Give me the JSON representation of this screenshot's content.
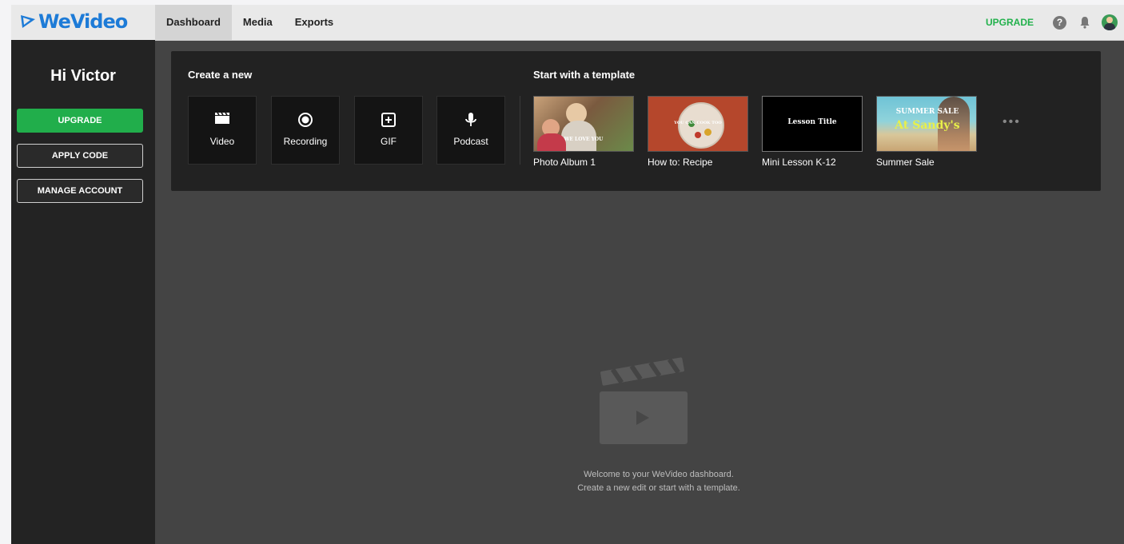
{
  "app": {
    "logo_text": "WeVideo"
  },
  "nav": {
    "tabs": [
      {
        "label": "Dashboard"
      },
      {
        "label": "Media"
      },
      {
        "label": "Exports"
      }
    ]
  },
  "topbar": {
    "upgrade_label": "UPGRADE",
    "help_glyph": "?"
  },
  "sidebar": {
    "greeting": "Hi Victor",
    "buttons": [
      {
        "label": "UPGRADE"
      },
      {
        "label": "APPLY CODE"
      },
      {
        "label": "MANAGE ACCOUNT"
      }
    ]
  },
  "create": {
    "heading": "Create a new",
    "items": [
      {
        "label": "Video",
        "icon": "clapperboard-icon"
      },
      {
        "label": "Recording",
        "icon": "record-icon"
      },
      {
        "label": "GIF",
        "icon": "gif-icon"
      },
      {
        "label": "Podcast",
        "icon": "microphone-icon"
      }
    ]
  },
  "templates": {
    "heading": "Start with a template",
    "items": [
      {
        "label": "Photo Album 1",
        "thumb_text": "WE LOVE YOU"
      },
      {
        "label": "How to: Recipe",
        "thumb_text": "YOU CAN COOK TOO"
      },
      {
        "label": "Mini Lesson K-12",
        "thumb_text": "Lesson Title"
      },
      {
        "label": "Summer Sale",
        "thumb_text": "SUMMER SALE",
        "thumb_text2": "At Sandy's"
      }
    ],
    "more_label": "•••"
  },
  "empty_state": {
    "line1": "Welcome to your WeVideo dashboard.",
    "line2": "Create a new edit or start with a template."
  },
  "colors": {
    "accent_green": "#21ae4b",
    "logo_blue": "#1d7bd7"
  }
}
